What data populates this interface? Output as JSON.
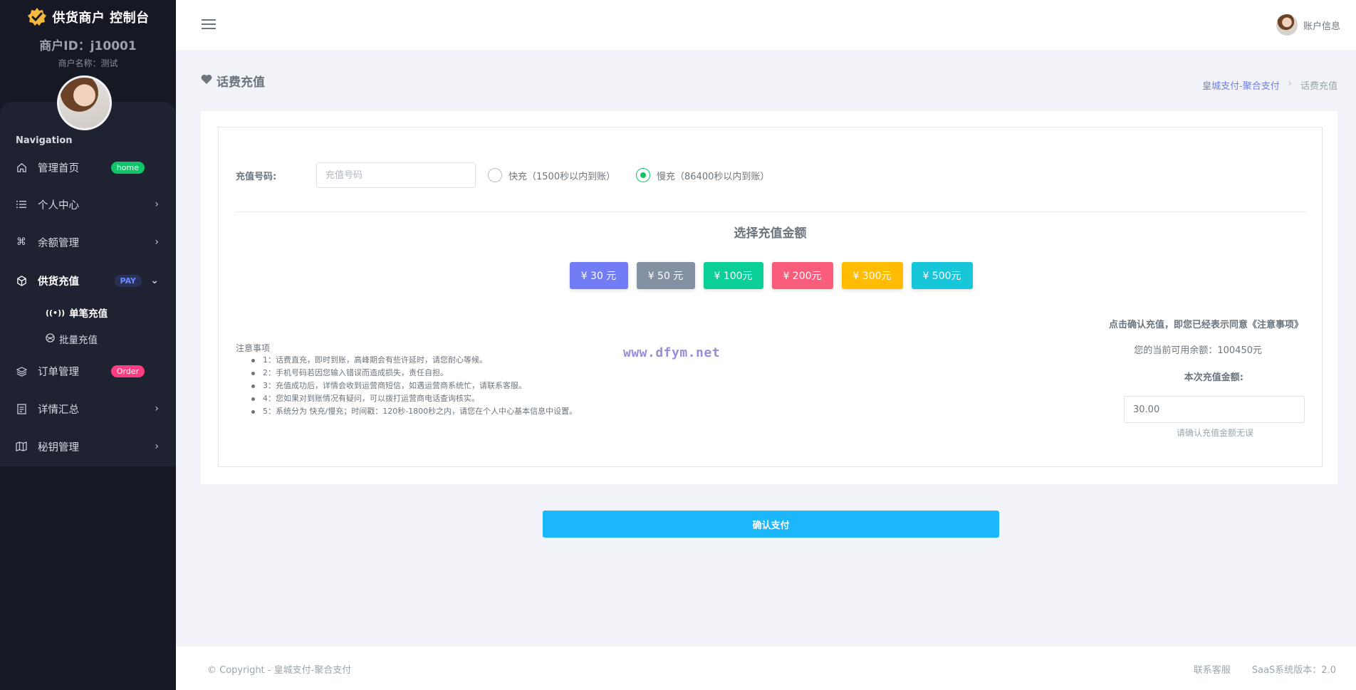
{
  "sidebar": {
    "brand_title": "供货商户 控制台",
    "merchant_id": "商户ID：j10001",
    "merchant_name": "商户名称：测试",
    "nav_heading": "Navigation",
    "items": [
      {
        "label": "管理首页",
        "icon": "home-icon",
        "badge": "home"
      },
      {
        "label": "个人中心",
        "icon": "list-icon"
      },
      {
        "label": "余额管理",
        "icon": "command-icon"
      },
      {
        "label": "供货充值",
        "icon": "box-icon",
        "badge": "PAY"
      },
      {
        "label": "订单管理",
        "icon": "layers-icon",
        "badge": "Order"
      },
      {
        "label": "详情汇总",
        "icon": "receipt-icon"
      },
      {
        "label": "秘钥管理",
        "icon": "map-icon"
      }
    ],
    "sub_items": [
      {
        "label": "单笔充值",
        "icon": "broadcast-icon"
      },
      {
        "label": "批量充值",
        "icon": "globe-icon"
      }
    ]
  },
  "topbar": {
    "account_label": "账户信息"
  },
  "page": {
    "title": "话费充值",
    "breadcrumb": [
      "皇城支付-聚合支付",
      "话费充值"
    ]
  },
  "form": {
    "phone_label": "充值号码:",
    "phone_placeholder": "充值号码",
    "radio_fast": "快充（1500秒以内到账）",
    "radio_slow": "慢充（86400秒以内到账）",
    "selected_mode": "slow",
    "amount_title": "选择充值金额",
    "amounts": [
      {
        "label": "¥ 30 元",
        "color": "#727cf5"
      },
      {
        "label": "¥ 50 元",
        "color": "#8391a2"
      },
      {
        "label": "¥ 100元",
        "color": "#0acf97"
      },
      {
        "label": "¥ 200元",
        "color": "#fa5c7c"
      },
      {
        "label": "¥ 300元",
        "color": "#ffbc00"
      },
      {
        "label": "¥ 500元",
        "color": "#17c6d9"
      }
    ],
    "notes_title": "注意事项",
    "notes": [
      "1：话费直充，即时到账，高峰期会有些许延时，请您耐心等候。",
      "2：手机号码若因您输入错误而造成损失，责任自担。",
      "3：充值成功后，详情会收到运营商短信，如遇运营商系统忙，请联系客服。",
      "4：您如果对到账情况有疑问，可以拨打运营商电话查询核实。",
      "5：系统分为 快充/慢充；时间戳：120秒-1800秒之内，请您在个人中心基本信息中设置。"
    ],
    "watermark": "www.dfym.net",
    "agree_text": "点击确认充值，即您已经表示同意《注意事项》",
    "balance_text": "您的当前可用余额：100450元",
    "this_amount_label": "本次充值金额:",
    "amount_value": "30.00",
    "hint": "请确认充值金额无误",
    "pay_button": "确认支付"
  },
  "footer": {
    "copyright": "© Copyright - 皇城支付-聚合支付",
    "contact": "联系客服",
    "version": "SaaS系统版本：2.0"
  }
}
